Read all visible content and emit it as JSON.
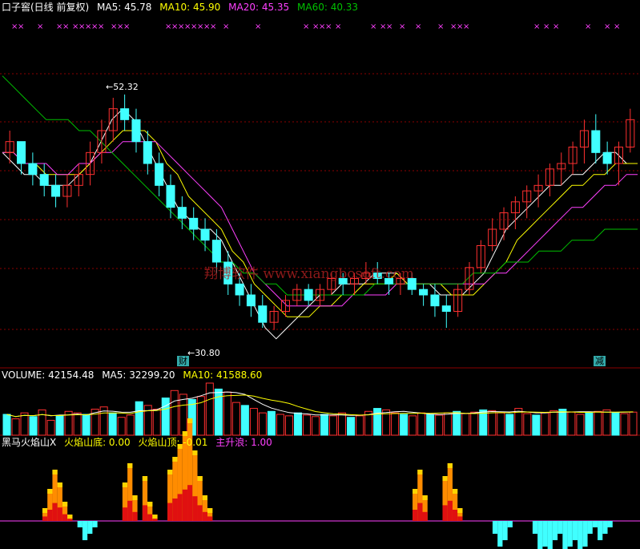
{
  "header": {
    "title": "口子窖(日线 前复权)",
    "ma5": "MA5: 45.78",
    "ma10": "MA10: 45.90",
    "ma20": "MA20: 45.35",
    "ma60": "MA60: 40.33"
  },
  "volume_header": {
    "label": "VOLUME: 42154.48",
    "ma5": "MA5: 32299.20",
    "ma10": "MA10: 41588.60"
  },
  "indicator_header": {
    "label": "黑马火焰山X",
    "bottom": "火焰山底: 0.00",
    "top": "火焰山顶: -0.01",
    "rise": "主升浪: 1.00"
  },
  "annotations": {
    "high_price": "52.32",
    "low_price": "30.80",
    "watermark": "翔博软件 www.xiangbosoft.com",
    "signal_buy": "财",
    "signal_sell": "减"
  },
  "colors": {
    "up": "#ff3030",
    "down": "#40ffff",
    "ma5": "#ffffff",
    "ma10": "#ffff00",
    "ma20": "#ff40ff",
    "ma60": "#00c000",
    "grid": "#8b0000"
  },
  "chart_data": [
    {
      "type": "candlestick",
      "title": "口子窖(日线 前复权)",
      "annotations": [
        "52.32",
        "30.80"
      ],
      "series": [
        {
          "name": "MA5",
          "values": [
            47,
            46,
            45,
            45,
            44,
            44,
            44,
            45,
            46,
            48,
            50,
            51,
            50,
            48,
            46,
            44,
            42,
            41,
            40,
            40,
            39,
            37,
            35,
            33,
            31,
            30,
            31,
            32,
            33,
            34,
            34,
            35,
            35,
            35,
            36,
            36,
            36,
            35,
            35,
            35,
            34,
            34,
            34,
            35,
            36,
            38,
            40,
            41,
            42,
            43,
            44,
            44,
            45,
            45,
            46,
            47,
            47,
            46,
            46
          ]
        },
        {
          "name": "MA10",
          "values": [
            47,
            47,
            46,
            46,
            45,
            45,
            45,
            45,
            46,
            47,
            48,
            49,
            49,
            49,
            48,
            46,
            45,
            43,
            42,
            41,
            40,
            38,
            37,
            35,
            34,
            33,
            32,
            32,
            32,
            33,
            33,
            34,
            34,
            35,
            35,
            35,
            36,
            35,
            35,
            35,
            35,
            34,
            34,
            34,
            35,
            36,
            37,
            39,
            40,
            41,
            42,
            43,
            44,
            44,
            45,
            45,
            46,
            46,
            46
          ]
        },
        {
          "name": "MA20",
          "values": [
            47,
            47,
            46,
            46,
            46,
            45,
            45,
            46,
            46,
            47,
            47,
            48,
            48,
            48,
            48,
            47,
            46,
            45,
            44,
            43,
            42,
            40,
            38,
            36,
            35,
            34,
            33,
            33,
            33,
            33,
            33,
            33,
            34,
            34,
            34,
            34,
            35,
            35,
            35,
            35,
            35,
            35,
            35,
            35,
            35,
            36,
            36,
            37,
            38,
            39,
            40,
            41,
            42,
            42,
            43,
            44,
            44,
            45,
            45
          ]
        },
        {
          "name": "MA60",
          "values": [
            54,
            53,
            52,
            51,
            50,
            50,
            50,
            49,
            49,
            48,
            47,
            46,
            45,
            44,
            43,
            42,
            41,
            40,
            39,
            38,
            37,
            37,
            36,
            36,
            35,
            35,
            34,
            34,
            34,
            34,
            34,
            34,
            34,
            34,
            35,
            35,
            35,
            35,
            35,
            35,
            35,
            35,
            35,
            36,
            36,
            36,
            37,
            37,
            37,
            38,
            38,
            38,
            39,
            39,
            39,
            40,
            40,
            40,
            40
          ]
        }
      ],
      "candles": [
        [
          47,
          49,
          46,
          48
        ],
        [
          48,
          48,
          45,
          46
        ],
        [
          46,
          47,
          44,
          45
        ],
        [
          45,
          46,
          43,
          44
        ],
        [
          44,
          45,
          42,
          43
        ],
        [
          43,
          45,
          42,
          44
        ],
        [
          44,
          46,
          43,
          45
        ],
        [
          45,
          48,
          44,
          47
        ],
        [
          47,
          50,
          46,
          49
        ],
        [
          49,
          52,
          48,
          51
        ],
        [
          51,
          52.3,
          49,
          50
        ],
        [
          50,
          51,
          47,
          48
        ],
        [
          48,
          49,
          45,
          46
        ],
        [
          46,
          47,
          43,
          44
        ],
        [
          44,
          45,
          41,
          42
        ],
        [
          42,
          43,
          40,
          41
        ],
        [
          41,
          42,
          39,
          40
        ],
        [
          40,
          41,
          38,
          39
        ],
        [
          39,
          40,
          36,
          37
        ],
        [
          37,
          38,
          34,
          35
        ],
        [
          35,
          36,
          33,
          34
        ],
        [
          34,
          35,
          32,
          33
        ],
        [
          33,
          34,
          31,
          31.5
        ],
        [
          31.5,
          33,
          30.8,
          32.5
        ],
        [
          32.5,
          34,
          32,
          33.5
        ],
        [
          33.5,
          35,
          33,
          34.5
        ],
        [
          34.5,
          35,
          33,
          33.5
        ],
        [
          33.5,
          35,
          33,
          34.5
        ],
        [
          34.5,
          36,
          34,
          35.5
        ],
        [
          35.5,
          36,
          34,
          35
        ],
        [
          35,
          36,
          34,
          35.5
        ],
        [
          35.5,
          37,
          35,
          36
        ],
        [
          36,
          37,
          35,
          35.5
        ],
        [
          35.5,
          36,
          34,
          35
        ],
        [
          35,
          36,
          34,
          35.5
        ],
        [
          35.5,
          36,
          34,
          34.5
        ],
        [
          34.5,
          35,
          33,
          34
        ],
        [
          34,
          35,
          32,
          33
        ],
        [
          33,
          34,
          31,
          32.5
        ],
        [
          32.5,
          35,
          32,
          34.5
        ],
        [
          34.5,
          37,
          34,
          36.5
        ],
        [
          36.5,
          39,
          36,
          38.5
        ],
        [
          38.5,
          41,
          38,
          40
        ],
        [
          40,
          42,
          39,
          41.5
        ],
        [
          41.5,
          43,
          40,
          42.5
        ],
        [
          42.5,
          44,
          41,
          43.5
        ],
        [
          43.5,
          45,
          42,
          44
        ],
        [
          44,
          46,
          43,
          45.5
        ],
        [
          45.5,
          47,
          44,
          46
        ],
        [
          46,
          48,
          45,
          47.5
        ],
        [
          47.5,
          50,
          46,
          49
        ],
        [
          49,
          50.5,
          46,
          47
        ],
        [
          47,
          48,
          45,
          46
        ],
        [
          46,
          48,
          44,
          47.5
        ],
        [
          47.5,
          51,
          47,
          50
        ]
      ],
      "xlabel": "",
      "ylabel": ""
    },
    {
      "type": "bar",
      "title": "VOLUME: 42154.48",
      "series": [
        {
          "name": "MA5",
          "values": [
            32299.2
          ]
        },
        {
          "name": "MA10",
          "values": [
            41588.6
          ]
        }
      ],
      "values": [
        28,
        22,
        30,
        25,
        34,
        20,
        26,
        32,
        30,
        28,
        35,
        38,
        30,
        24,
        27,
        45,
        40,
        35,
        50,
        60,
        55,
        48,
        52,
        70,
        62,
        58,
        44,
        40,
        36,
        30,
        32,
        28,
        26,
        30,
        27,
        25,
        28,
        26,
        30,
        24,
        26,
        32,
        36,
        34,
        30,
        28,
        26,
        30,
        28,
        27,
        30,
        32,
        29,
        31,
        34,
        33,
        30,
        28,
        36,
        29,
        27,
        30,
        33,
        35,
        31,
        28,
        30,
        32,
        34,
        30,
        29,
        31
      ]
    },
    {
      "type": "bar",
      "title": "黑马火焰山X",
      "legend": [
        "火焰山底: 0.00",
        "火焰山顶: -0.01",
        "主升浪: 1.00"
      ],
      "values": [
        0,
        0,
        0,
        0,
        0,
        0,
        0,
        0,
        2,
        5,
        8,
        6,
        3,
        1,
        0,
        -1,
        -3,
        -2,
        -1,
        0,
        0,
        0,
        0,
        0,
        6,
        9,
        4,
        0,
        7,
        3,
        1,
        0,
        0,
        8,
        10,
        12,
        14,
        16,
        11,
        7,
        4,
        2,
        0,
        0,
        0,
        0,
        0,
        0,
        0,
        0,
        0,
        0,
        0,
        0,
        0,
        0,
        0,
        0,
        0,
        0,
        0,
        0,
        0,
        0,
        0,
        0,
        0,
        0,
        0,
        0,
        0,
        0,
        0,
        0,
        0,
        0,
        0,
        0,
        0,
        0,
        0,
        0,
        5,
        8,
        4,
        0,
        0,
        0,
        7,
        9,
        5,
        2,
        0,
        0,
        0,
        0,
        0,
        0,
        -2,
        -4,
        -3,
        -1,
        0,
        0,
        0,
        0,
        -2,
        -5,
        -4,
        -6,
        -3,
        -2,
        -5,
        -4,
        -3,
        -6,
        -4,
        -2,
        -1,
        -3,
        -2,
        -1,
        0,
        0,
        0,
        0,
        0
      ]
    }
  ]
}
